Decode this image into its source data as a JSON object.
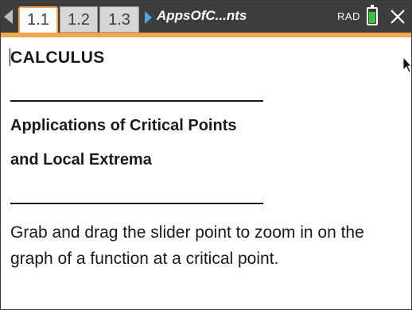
{
  "toolbar": {
    "tabs": [
      {
        "label": "1.1",
        "active": true
      },
      {
        "label": "1.2",
        "active": false
      },
      {
        "label": "1.3",
        "active": false
      }
    ],
    "doc_title": "AppsOfC...nts",
    "angle_mode": "RAD",
    "battery_level": 0.85,
    "icons": {
      "prev": "chevron-left-icon",
      "doc": "triangle-right-icon",
      "battery": "battery-icon",
      "close": "close-icon"
    },
    "colors": {
      "bar_bg": "#3d3d3d",
      "accent": "#f0a84a",
      "doc_arrow": "#4aa6e8",
      "battery": "#39c43b"
    }
  },
  "document": {
    "heading": "CALCULUS",
    "subtitle_line1": "Applications of Critical Points",
    "subtitle_line2": "and Local Extrema",
    "body": "Grab and drag the slider point to zoom in on the graph of a function at a critical point."
  }
}
